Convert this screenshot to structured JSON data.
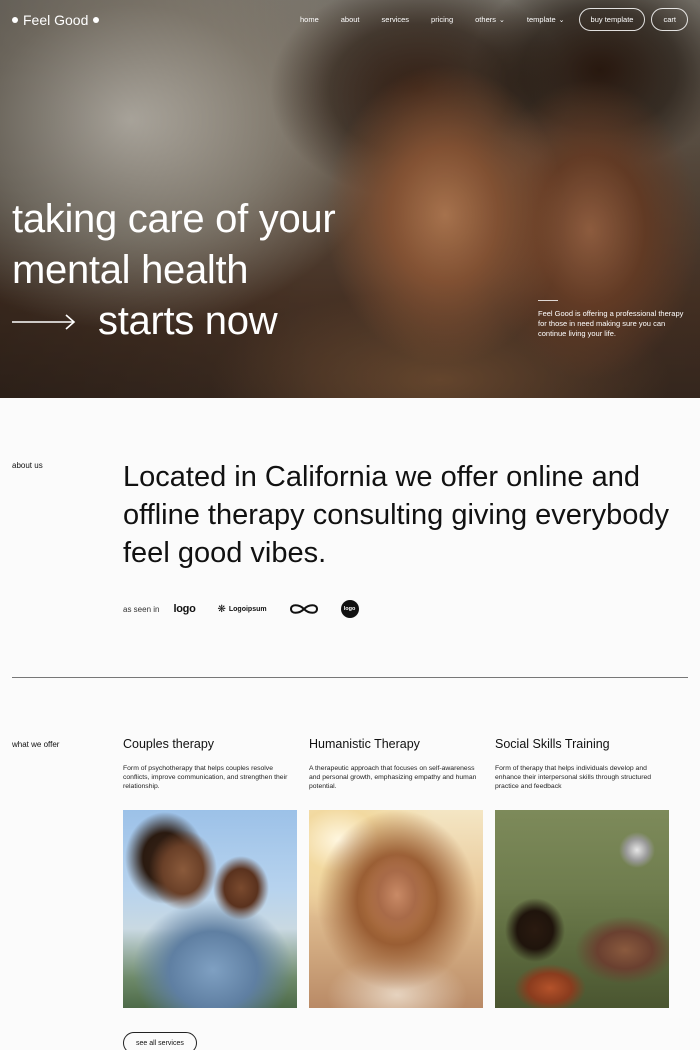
{
  "brand": {
    "name": "Feel Good"
  },
  "nav": {
    "items": [
      {
        "label": "home"
      },
      {
        "label": "about"
      },
      {
        "label": "services"
      },
      {
        "label": "pricing"
      },
      {
        "label": "others"
      },
      {
        "label": "template"
      }
    ],
    "buy_label": "buy template",
    "cart_label": "cart"
  },
  "hero": {
    "line1": "taking care of your",
    "line2": "mental health",
    "line3": "starts now",
    "description": "Feel Good is offering a professional therapy for those in need making sure you can continue living your life."
  },
  "about": {
    "label": "about us",
    "text": "Located in California we offer online and offline therapy consulting giving everybody feel good vibes.",
    "seen_in": "as seen in",
    "brands": [
      "logo",
      "Logoipsum",
      "logo"
    ]
  },
  "services": {
    "label": "what we offer",
    "cards": [
      {
        "title": "Couples therapy",
        "description": "Form of psychotherapy that helps couples resolve conflicts, improve communication, and strengthen their relationship."
      },
      {
        "title": "Humanistic Therapy",
        "description": "A therapeutic approach that focuses on self-awareness and personal growth, emphasizing empathy and human potential."
      },
      {
        "title": "Social Skills Training",
        "description": "Form of therapy that helps individuals develop and enhance their interpersonal skills through structured practice and feedback"
      }
    ],
    "see_all": "see all services"
  },
  "colors": {
    "text": "#111111",
    "background": "#fbfbfb",
    "hero_text": "#ffffff"
  }
}
